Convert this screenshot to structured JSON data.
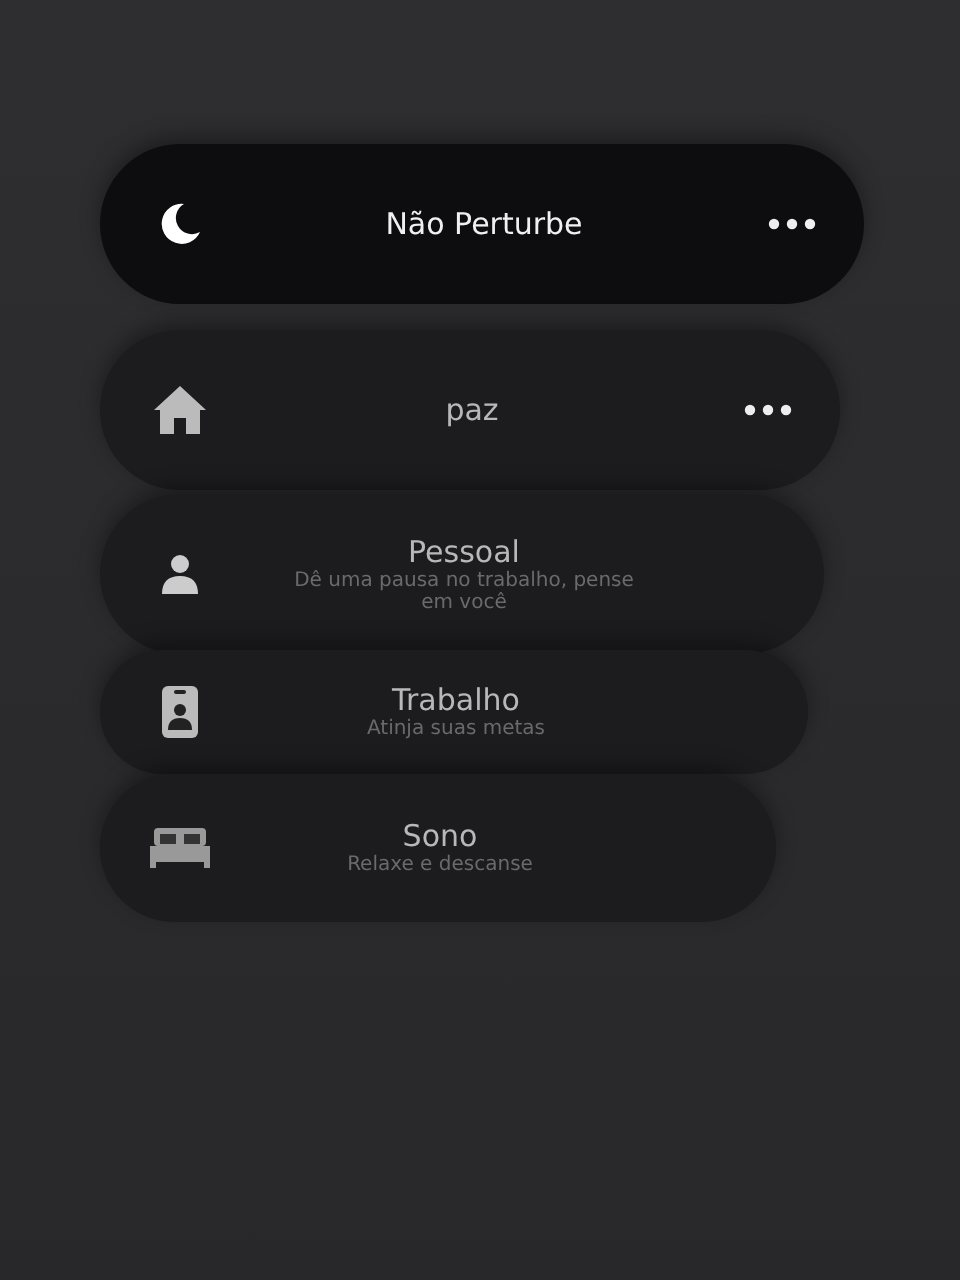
{
  "focus_modes": [
    {
      "kind": "moon",
      "title": "Não Perturbe",
      "menu": true,
      "selected": true
    },
    {
      "kind": "house",
      "title": "paz",
      "menu": true,
      "selected": false
    },
    {
      "kind": "person",
      "title": "Pessoal",
      "subtitle": "Dê uma pausa no trabalho, pense em você",
      "menu": false,
      "selected": false
    },
    {
      "kind": "badge",
      "title": "Trabalho",
      "subtitle": "Atinja suas metas",
      "menu": false,
      "selected": false
    },
    {
      "kind": "bed",
      "title": "Sono",
      "subtitle": "Relaxe e descanse",
      "menu": false,
      "selected": false
    }
  ]
}
